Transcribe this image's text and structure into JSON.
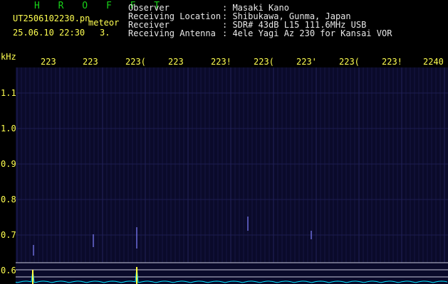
{
  "brand": "H R O F F T",
  "file_name": "UT2506102230.pn",
  "tag": "meteor",
  "datetime": "25.06.10 22:30",
  "count": "3.",
  "meta": [
    {
      "label": "Observer",
      "value": ": Masaki Kano"
    },
    {
      "label": "Receiving Location",
      "value": ": Shibukawa, Gunma, Japan"
    },
    {
      "label": "Receiver",
      "value": ": SDR# 43dB L15 111.6MHz USB"
    },
    {
      "label": "Receiving Antenna",
      "value": ": 4ele Yagi Az 230 for Kansai VOR"
    }
  ],
  "axis": {
    "y_unit": "kHz",
    "y_ticks": [
      "1.1",
      "1.0",
      "0.9",
      "0.8",
      "0.7",
      "0.6"
    ],
    "x_ticks": [
      "223",
      "223",
      "223(",
      "223",
      "223!",
      "223(",
      "223'",
      "223(",
      "223!",
      "2240"
    ]
  },
  "colors": {
    "background": "#0a0a2a",
    "grid": "#242460",
    "trace": "#00e5ff",
    "echo": "#ffff40",
    "hline": "#c8c8dc"
  }
}
